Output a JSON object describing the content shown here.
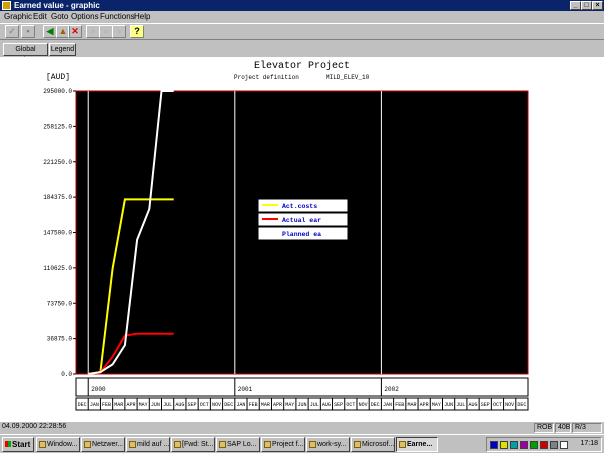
{
  "window": {
    "title": "Earned value - graphic"
  },
  "menu": [
    "Graphic",
    "Edit",
    "Goto",
    "Options",
    "Functions",
    "Help"
  ],
  "buttons": {
    "global_options": "Global options",
    "legend": "Legend"
  },
  "graphic": {
    "title": "Elevator Project",
    "subtitle_label": "Project definition",
    "subtitle_value": "MILD_ELEV_10",
    "currency": "[AUD]"
  },
  "chart_data": {
    "type": "line",
    "ylim": [
      0,
      295000
    ],
    "y_ticks": [
      "295000.0",
      "258125.0",
      "221250.0",
      "184375.0",
      "147500.0",
      "110625.0",
      "73750.0",
      "36875.0",
      "0.0"
    ],
    "x_months": [
      "DEC",
      "JAN",
      "FEB",
      "MAR",
      "APR",
      "MAY",
      "JUN",
      "JUL",
      "AUG",
      "SEP",
      "OCT",
      "NOV",
      "DEC",
      "JAN",
      "FEB",
      "MAR",
      "APR",
      "MAY",
      "JUN",
      "JUL",
      "AUG",
      "SEP",
      "OCT",
      "NOV",
      "DEC",
      "JAN",
      "FEB",
      "MAR",
      "APR",
      "MAY",
      "JUN",
      "JUL",
      "AUG",
      "SEP",
      "OCT",
      "NOV",
      "DEC"
    ],
    "x_years": [
      {
        "label": "2000",
        "start_month": 1
      },
      {
        "label": "2001",
        "start_month": 13
      },
      {
        "label": "2002",
        "start_month": 25
      }
    ],
    "legend": [
      "Act.costs",
      "Actual ear",
      "Planned ea"
    ],
    "series": [
      {
        "name": "Act.costs",
        "color": "#ffff00",
        "points": [
          [
            1.0,
            0
          ],
          [
            2.0,
            2000
          ],
          [
            3.0,
            110000
          ],
          [
            4.0,
            182000
          ],
          [
            5.0,
            182000
          ],
          [
            6.0,
            182000
          ],
          [
            7.0,
            182000
          ],
          [
            8.0,
            182000
          ]
        ]
      },
      {
        "name": "Actual ear",
        "color": "#ff0000",
        "points": [
          [
            1.0,
            0
          ],
          [
            2.0,
            2000
          ],
          [
            3.0,
            18000
          ],
          [
            4.0,
            40000
          ],
          [
            5.0,
            42000
          ],
          [
            6.0,
            42000
          ],
          [
            7.0,
            42000
          ],
          [
            8.0,
            42000
          ]
        ]
      },
      {
        "name": "Planned ea",
        "color": "#ffffff",
        "points": [
          [
            1.0,
            0
          ],
          [
            2.0,
            2000
          ],
          [
            3.0,
            10000
          ],
          [
            4.0,
            30000
          ],
          [
            5.0,
            140000
          ],
          [
            6.0,
            172000
          ],
          [
            7.0,
            295000
          ],
          [
            8.0,
            295000
          ]
        ]
      }
    ]
  },
  "status": {
    "date": "04.09.2000",
    "time": "22:28:56",
    "user": "ROB",
    "field2": "40B",
    "system": "R/3"
  },
  "taskbar": {
    "start": "Start",
    "tasks": [
      "Window...",
      "Netzwer...",
      "mild auf ...",
      "[Fwd: St...",
      "SAP Lo...",
      "Project f...",
      "work-sy...",
      "Microsof...",
      "Earne..."
    ],
    "clock": "17:18"
  }
}
